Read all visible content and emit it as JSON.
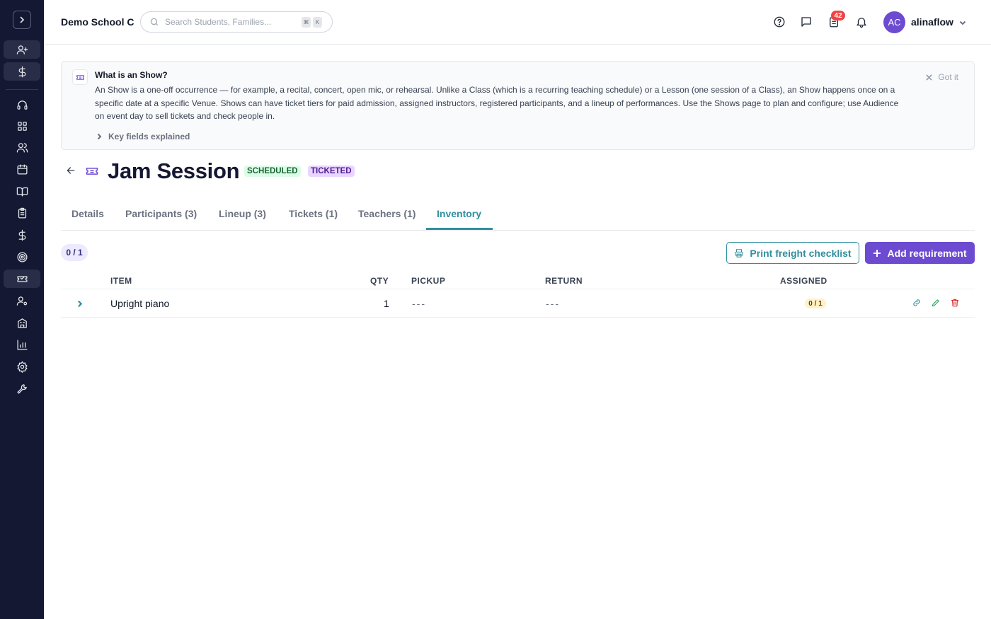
{
  "header": {
    "school_name": "Demo School C",
    "search_placeholder": "Search Students, Families...",
    "kbd_mod": "⌘",
    "kbd_key": "K",
    "task_badge_count": "42",
    "avatar_initials": "AC",
    "username": "alinaflow"
  },
  "banner": {
    "title": "What is an Show?",
    "body": "An Show is a one-off occurrence — for example, a recital, concert, open mic, or rehearsal. Unlike a Class (which is a recurring teaching schedule) or a Lesson (one session of a Class), an Show happens once on a specific date at a specific Venue. Shows can have ticket tiers for paid admission, assigned instructors, registered participants, and a lineup of performances. Use the Shows page to plan and configure; use Audience on event day to sell tickets and check people in.",
    "dismiss_label": "Got it",
    "key_fields_label": "Key fields explained"
  },
  "page": {
    "title": "Jam Session",
    "status_badges": [
      "SCHEDULED",
      "TICKETED"
    ]
  },
  "tabs": [
    {
      "label": "Details",
      "active": false
    },
    {
      "label": "Participants (3)",
      "active": false
    },
    {
      "label": "Lineup (3)",
      "active": false
    },
    {
      "label": "Tickets (1)",
      "active": false
    },
    {
      "label": "Teachers (1)",
      "active": false
    },
    {
      "label": "Inventory",
      "active": true
    }
  ],
  "toolbar": {
    "summary_count": "0 / 1",
    "print_label": "Print freight checklist",
    "add_label": "Add requirement"
  },
  "table": {
    "columns": [
      "ITEM",
      "QTY",
      "PICKUP",
      "RETURN",
      "ASSIGNED"
    ],
    "rows": [
      {
        "item": "Upright piano",
        "qty": "1",
        "pickup": "---",
        "return": "---",
        "assigned": "0 / 1"
      }
    ]
  },
  "sidebar": {
    "items": [
      "add-user",
      "billing",
      "support",
      "dashboard",
      "people",
      "calendar",
      "book",
      "clipboard",
      "billing-secondary",
      "target",
      "tickets",
      "user-settings",
      "building",
      "reports",
      "settings",
      "tools"
    ],
    "active": "tickets"
  },
  "colors": {
    "sidebar_bg": "#151832",
    "accent_teal": "#2f8f9d",
    "brand_purple": "#6d4bd1",
    "badge_red": "#ef4444"
  }
}
